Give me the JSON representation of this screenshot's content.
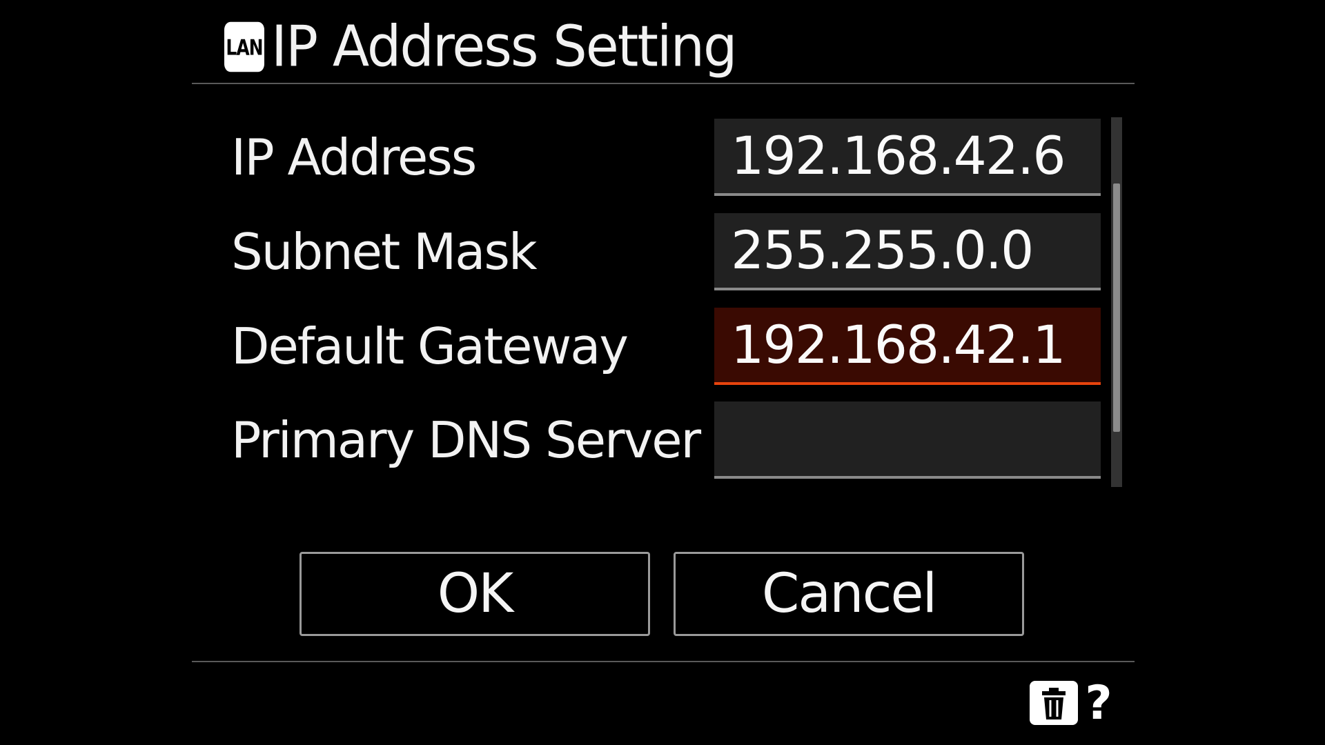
{
  "header": {
    "badge": "LAN",
    "title": "IP Address Setting"
  },
  "settings": [
    {
      "label": "IP Address",
      "value": "192.168.42.6",
      "selected": false
    },
    {
      "label": "Subnet Mask",
      "value": "255.255.0.0",
      "selected": false
    },
    {
      "label": "Default Gateway",
      "value": "192.168.42.1",
      "selected": true
    },
    {
      "label": "Primary DNS Server",
      "value": "",
      "selected": false
    }
  ],
  "buttons": {
    "ok": "OK",
    "cancel": "Cancel"
  },
  "footer": {
    "delete_icon": "trash-icon",
    "help_label": "?"
  },
  "colors": {
    "background": "#000000",
    "field": "#212121",
    "selected_field": "#3a0a02",
    "selected_underline": "#e8440d"
  }
}
